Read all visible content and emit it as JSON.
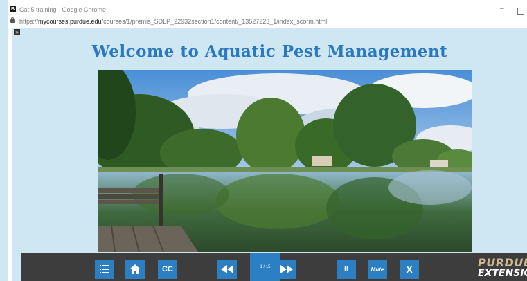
{
  "browser": {
    "window_title": "Cat 5 training - Google Chrome",
    "url_prefix": "https://",
    "url_domain": "mycourses.purdue.edu",
    "url_path": "/courses/1/premis_SDLP_22932section1/content/_13527223_1/index_scorm.html"
  },
  "page": {
    "heading": "Welcome to Aquatic Pest Management"
  },
  "player": {
    "controls": {
      "menu_icon": "list-icon",
      "home_icon": "home-icon",
      "cc_label": "CC",
      "rewind_icon": "rewind-icon",
      "slide_counter": "1 / 15",
      "forward_icon": "fast-forward-icon",
      "pause_label": "II",
      "mute_label": "Mute",
      "exit_label": "X"
    },
    "logo": {
      "line1": "PURDUE",
      "line2": "EXTENSION"
    }
  },
  "colors": {
    "button_blue": "#2b7fc2",
    "bar_bg": "#3d3d3d",
    "heading_blue": "#2a78c0",
    "page_bg": "#cfe6f3",
    "purdue_gold": "#cfb991"
  }
}
